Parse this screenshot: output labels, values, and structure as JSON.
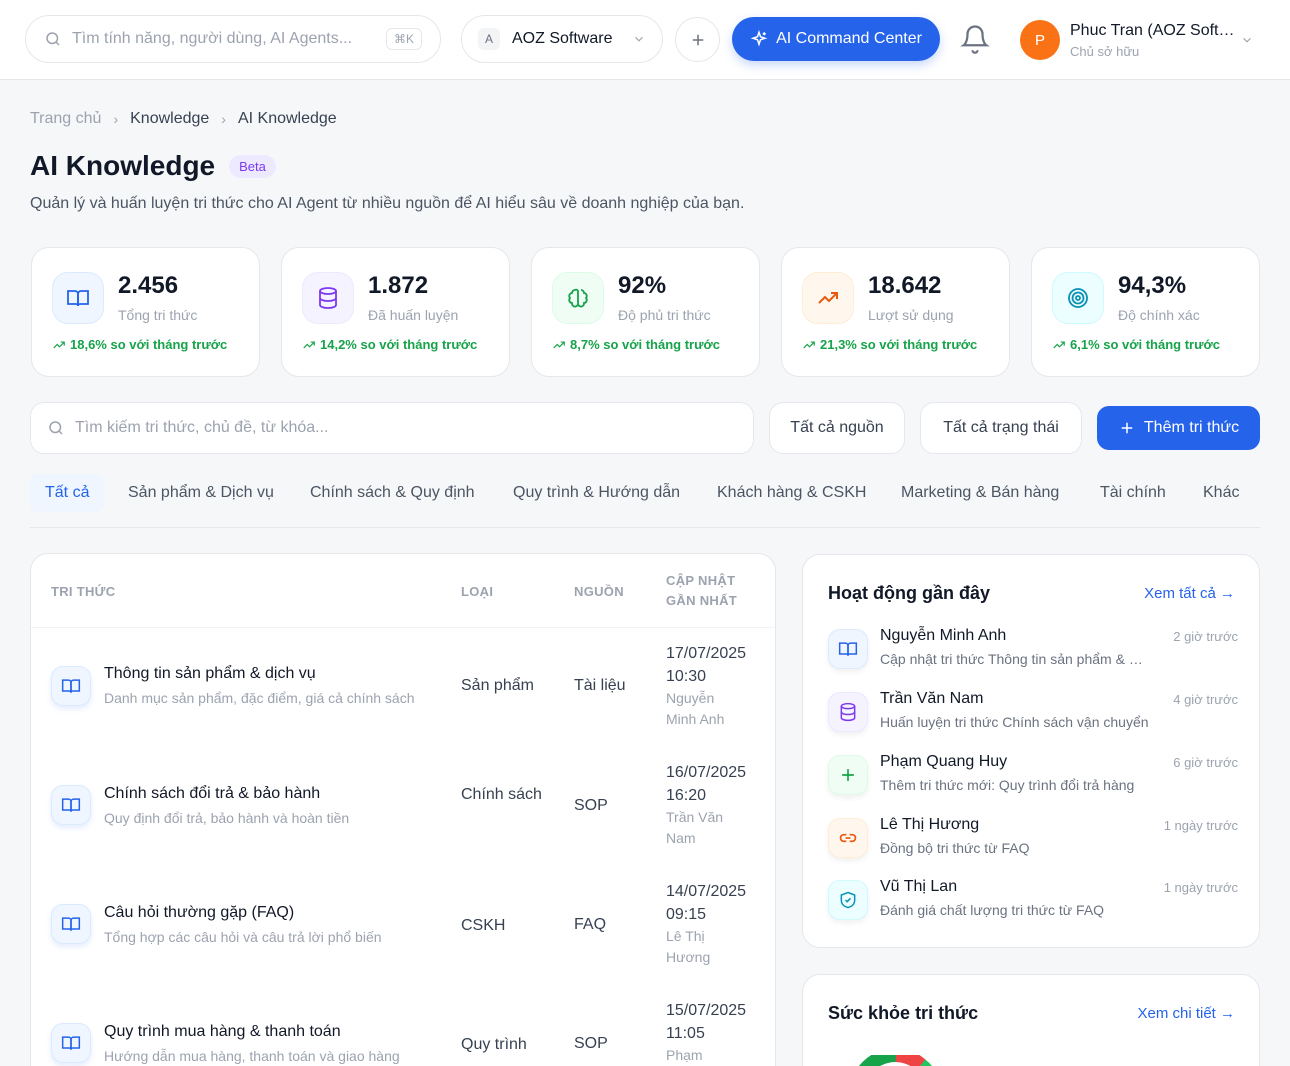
{
  "header": {
    "search_placeholder": "Tìm tính năng, người dùng, AI Agents...",
    "shortcut": "⌘K",
    "org_initial": "A",
    "org_name": "AOZ Software",
    "ai_button": "AI Command Center",
    "user_initial": "P",
    "user_name": "Phuc Tran (AOZ Software)",
    "user_role": "Chủ sở hữu"
  },
  "breadcrumb": [
    "Trang chủ",
    "Knowledge",
    "AI Knowledge"
  ],
  "page": {
    "title": "AI Knowledge",
    "badge": "Beta",
    "subtitle": "Quản lý và huấn luyện tri thức cho AI Agent từ nhiều nguồn để AI hiểu sâu về doanh nghiệp của bạn."
  },
  "stats": [
    {
      "value": "2.456",
      "label": "Tổng tri thức",
      "trend": "18,6% so với tháng trước",
      "icon": "book-icon",
      "color": "#2563eb"
    },
    {
      "value": "1.872",
      "label": "Đã huấn luyện",
      "trend": "14,2% so với tháng trước",
      "icon": "database-icon",
      "color": "#7c3aed"
    },
    {
      "value": "92%",
      "label": "Độ phủ tri thức",
      "trend": "8,7% so với tháng trước",
      "icon": "brain-icon",
      "color": "#16a34a"
    },
    {
      "value": "18.642",
      "label": "Lượt sử dụng",
      "trend": "21,3% so với tháng trước",
      "icon": "trend-up-icon",
      "color": "#ea580c"
    },
    {
      "value": "94,3%",
      "label": "Độ chính xác",
      "trend": "6,1% so với tháng trước",
      "icon": "target-icon",
      "color": "#0891b2"
    }
  ],
  "filters": {
    "search_placeholder": "Tìm kiếm tri thức, chủ đề, từ khóa...",
    "source": "Tất cả nguồn",
    "status": "Tất cả trạng thái",
    "add": "Thêm tri thức"
  },
  "tabs": [
    "Tất cả",
    "Sản phẩm & Dịch vụ",
    "Chính sách & Quy định",
    "Quy trình & Hướng dẫn",
    "Khách hàng & CSKH",
    "Marketing & Bán hàng",
    "Tài chính",
    "Khác"
  ],
  "table": {
    "columns": [
      "TRI THỨC",
      "LOẠI",
      "NGUỒN",
      "CẬP NHẬT GẦN NHẤT"
    ],
    "rows": [
      {
        "title": "Thông tin sản phẩm & dịch vụ",
        "desc": "Danh mục sản phẩm, đặc điểm, giá cả chính sách",
        "type": "Sản phẩm",
        "source": "Tài liệu",
        "date": "17/07/2025 10:30",
        "user": "Nguyễn Minh Anh"
      },
      {
        "title": "Chính sách đổi trả & bảo hành",
        "desc": "Quy định đổi trả, bảo hành và hoàn tiền",
        "type": "Chính sách",
        "source": "SOP",
        "date": "16/07/2025 16:20",
        "user": "Trần Văn Nam"
      },
      {
        "title": "Câu hỏi thường gặp (FAQ)",
        "desc": "Tổng hợp các câu hỏi và câu trả lời phổ biến",
        "type": "CSKH",
        "source": "FAQ",
        "date": "14/07/2025 09:15",
        "user": "Lê Thị Hương"
      },
      {
        "title": "Quy trình mua hàng & thanh toán",
        "desc": "Hướng dẫn mua hàng, thanh toán và giao hàng",
        "type": "Quy trình",
        "source": "SOP",
        "date": "15/07/2025 11:05",
        "user": "Phạm Quang Huy"
      }
    ]
  },
  "activity": {
    "title": "Hoạt động gần đây",
    "link": "Xem tất cả →",
    "items": [
      {
        "name": "Nguyễn Minh Anh",
        "time": "2 giờ trước",
        "desc": "Cập nhật tri thức Thông tin sản phẩm & dịch vụ",
        "icon": "book-icon",
        "color": "#2563eb",
        "bg": "#eff6ff"
      },
      {
        "name": "Trần Văn Nam",
        "time": "4 giờ trước",
        "desc": "Huấn luyện tri thức Chính sách vận chuyển",
        "icon": "database-icon",
        "color": "#7c3aed",
        "bg": "#f5f3ff"
      },
      {
        "name": "Phạm Quang Huy",
        "time": "6 giờ trước",
        "desc": "Thêm tri thức mới: Quy trình đổi trả hàng",
        "icon": "plus-icon",
        "color": "#16a34a",
        "bg": "#f0fdf4"
      },
      {
        "name": "Lê Thị Hương",
        "time": "1 ngày trước",
        "desc": "Đồng bộ tri thức từ FAQ",
        "icon": "link-icon",
        "color": "#ea580c",
        "bg": "#fff7ed"
      },
      {
        "name": "Vũ Thị Lan",
        "time": "1 ngày trước",
        "desc": "Đánh giá chất lượng tri thức từ FAQ",
        "icon": "shield-check-icon",
        "color": "#0891b2",
        "bg": "#ecfeff"
      }
    ]
  },
  "health": {
    "title": "Sức khỏe tri thức",
    "link": "Xem chi tiết →"
  }
}
